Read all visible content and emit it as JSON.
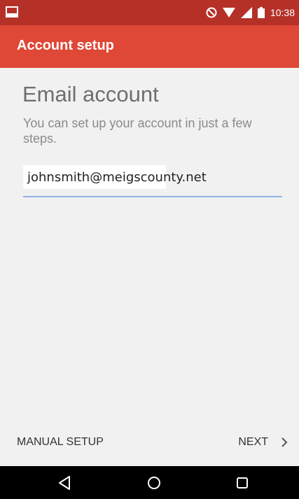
{
  "status_bar": {
    "time": "10:38",
    "color": "#b53128",
    "icons": [
      "notification-image-icon",
      "do-not-disturb-icon",
      "wifi-icon",
      "signal-icon",
      "battery-icon"
    ]
  },
  "app_bar": {
    "title": "Account setup",
    "color": "#df4736"
  },
  "main": {
    "heading": "Email account",
    "description": "You can set up your account in just a few steps.",
    "email_field": {
      "value": "johnsmith@meigscounty.net"
    }
  },
  "bottom_actions": {
    "manual_setup_label": "MANUAL SETUP",
    "next_label": "NEXT",
    "next_icon": "chevron-right-icon"
  },
  "nav_bar": {
    "buttons": [
      "back-icon",
      "home-icon",
      "recents-icon"
    ]
  }
}
